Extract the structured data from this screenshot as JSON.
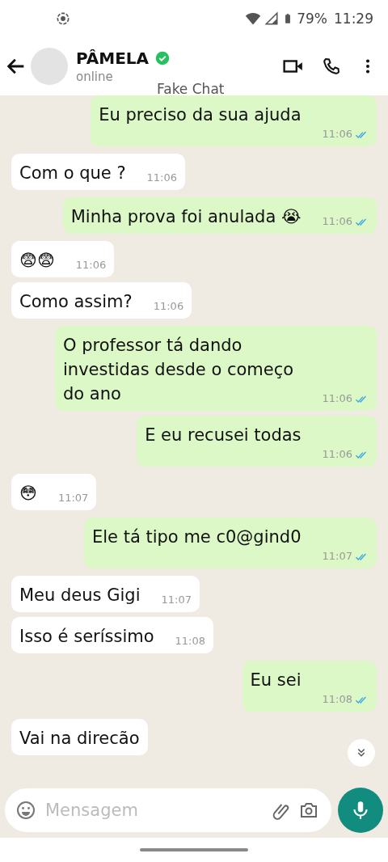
{
  "status_bar": {
    "battery": "79%",
    "time": "11:29"
  },
  "header": {
    "name": "PÂMELA",
    "verified": true,
    "status": "online",
    "watermark": "Fake Chat"
  },
  "messages": [
    {
      "kind": "sent",
      "text": "Eu preciso da sua ajuda",
      "time": "11:06",
      "read": true
    },
    {
      "kind": "received",
      "text": "Com o que ?",
      "time": "11:06"
    },
    {
      "kind": "sent",
      "text": "Minha prova foi anulada 😭",
      "time": "11:06",
      "read": true
    },
    {
      "kind": "received",
      "text": "😨😨",
      "time": "11:06"
    },
    {
      "kind": "received",
      "text": "Como assim?",
      "time": "11:06"
    },
    {
      "kind": "sent",
      "text": "O professor tá dando investidas desde o começo do ano",
      "time": "11:06",
      "read": true
    },
    {
      "kind": "sent",
      "text": "E eu recusei todas",
      "time": "11:06",
      "read": true
    },
    {
      "kind": "received",
      "text": "😳",
      "time": "11:07"
    },
    {
      "kind": "sent",
      "text": "Ele tá tipo me c0@gind0",
      "time": "11:07",
      "read": true
    },
    {
      "kind": "received",
      "text": "Meu deus Gigi",
      "time": "11:07"
    },
    {
      "kind": "received",
      "text": "Isso é seríssimo",
      "time": "11:08"
    },
    {
      "kind": "sent",
      "text": "Eu sei",
      "time": "11:08",
      "read": true
    },
    {
      "kind": "received",
      "text": "Vai na direcão"
    }
  ],
  "composer": {
    "placeholder": "Mensagem"
  }
}
